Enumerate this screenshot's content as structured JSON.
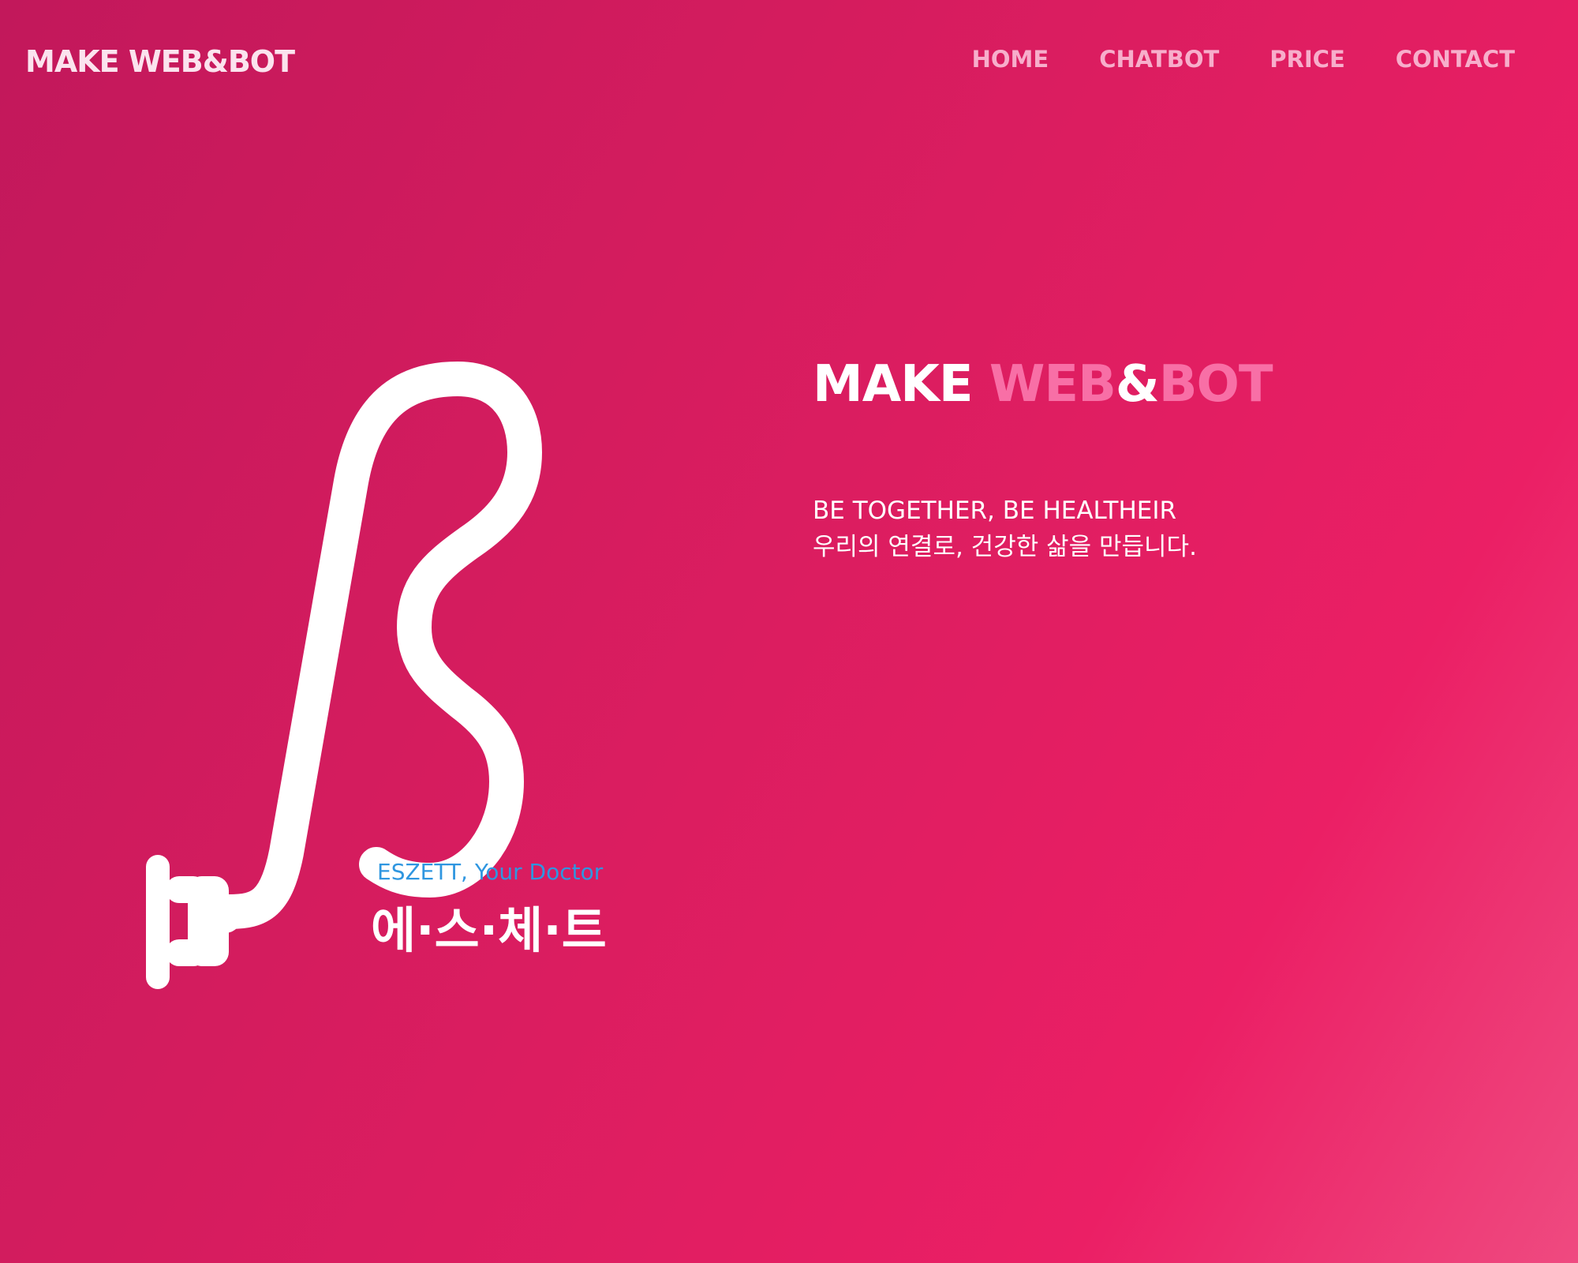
{
  "header": {
    "brand": "MAKE WEB&BOT",
    "nav": [
      "HOME",
      "CHATBOT",
      "PRICE",
      "CONTACT"
    ]
  },
  "logo": {
    "icon": "eszett-stethoscope-icon",
    "subtitle": "ESZETT, Your Doctor",
    "name_ko": "에·스·체·트"
  },
  "hero": {
    "title_make": "MAKE",
    "title_web": "WEB",
    "title_amp": "&",
    "title_bot": "BOT",
    "tagline_en": "BE TOGETHER, BE HEALTHEIR",
    "tagline_ko": "우리의 연결로, 건강한 삶을 만듭니다."
  },
  "colors": {
    "background_start": "#c2185b",
    "background_end": "#ef4a80",
    "nav_text": "#f7aecb",
    "accent_pink": "#f86fa6",
    "subtitle_blue": "#2f96e0"
  }
}
